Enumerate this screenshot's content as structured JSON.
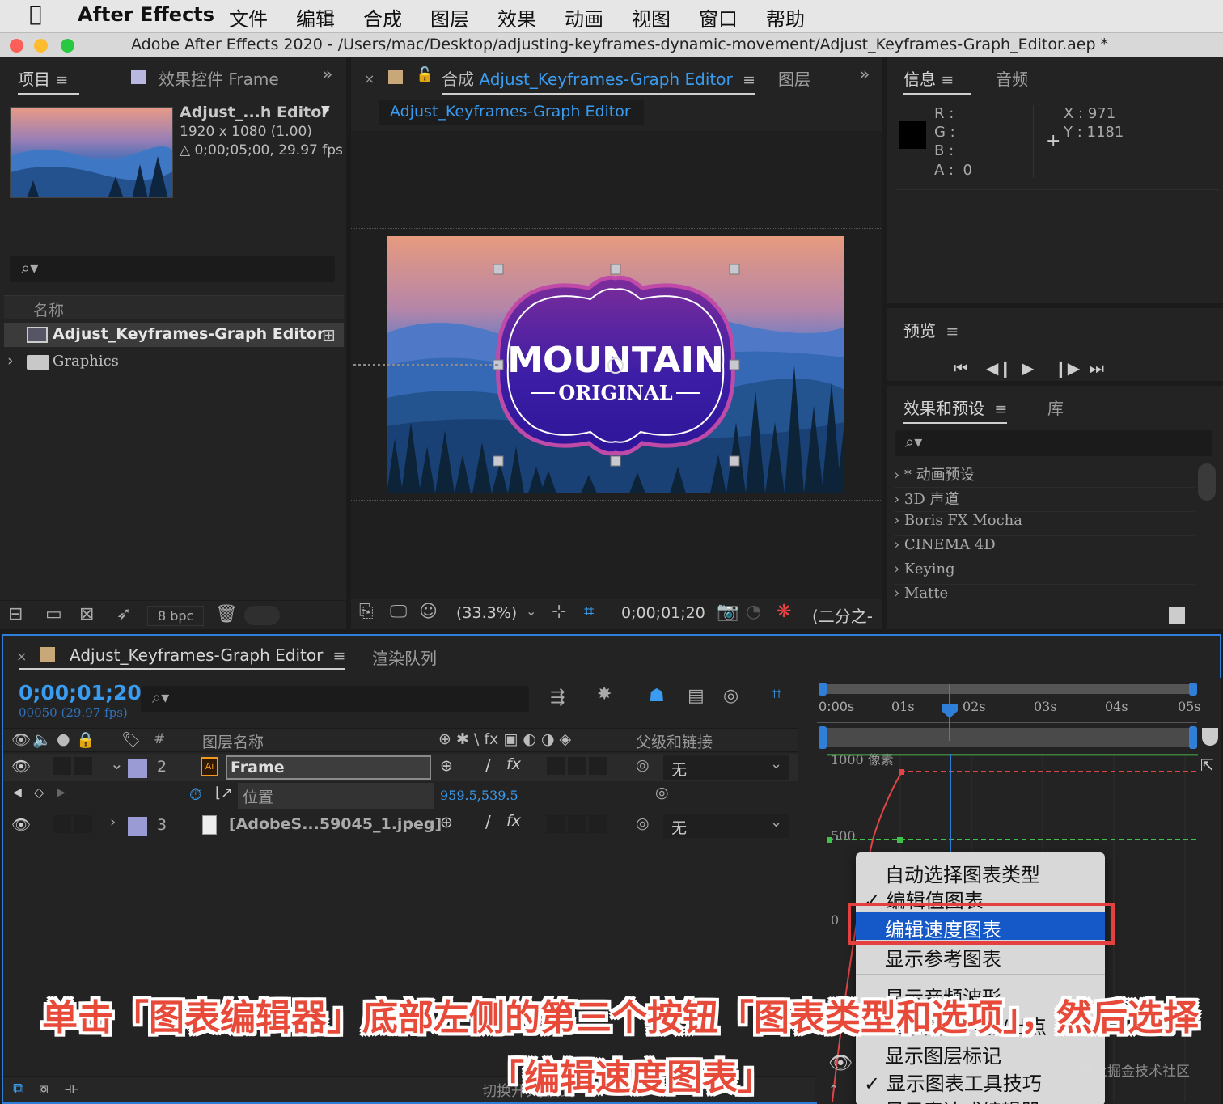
{
  "menubar": {
    "app": "After Effects",
    "items": [
      "文件",
      "编辑",
      "合成",
      "图层",
      "效果",
      "动画",
      "视图",
      "窗口",
      "帮助"
    ]
  },
  "window": {
    "title": "Adobe After Effects 2020 - /Users/mac/Desktop/adjusting-keyframes-dynamic-movement/Adjust_Keyframes-Graph_Editor.aep *"
  },
  "project": {
    "tab_project": "项目",
    "tab_effects": "效果控件 Frame",
    "comp_name": "Adjust_...h Editor",
    "comp_size": "1920 x 1080 (1.00)",
    "comp_duration": "△ 0;00;05;00, 29.97 fps",
    "col_name": "名称",
    "items": [
      {
        "name": "Adjust_Keyframes-Graph Editor"
      },
      {
        "name": "Graphics"
      }
    ],
    "bpc": "8 bpc"
  },
  "composition": {
    "tab_label": "合成",
    "tab_name": "Adjust_Keyframes-Graph Editor",
    "tab_layer": "图层",
    "subtab": "Adjust_Keyframes-Graph Editor",
    "badge_line1": "MOUNTAIN",
    "badge_line2": "ORIGINAL",
    "zoom": "(33.3%)",
    "timecode": "0;00;01;20",
    "resolution": "(二分之-"
  },
  "info": {
    "tab_info": "信息",
    "tab_audio": "音频",
    "r": "R :",
    "g": "G :",
    "b": "B :",
    "a": "A :  0",
    "x": "X : 971",
    "y": "Y : 1181"
  },
  "preview": {
    "title": "预览"
  },
  "effects": {
    "tab_effects": "效果和预设",
    "tab_library": "库",
    "items": [
      "* 动画预设",
      "3D 声道",
      "Boris FX Mocha",
      "CINEMA 4D",
      "Keying",
      "Matte"
    ]
  },
  "timeline": {
    "tab_comp": "Adjust_Keyframes-Graph Editor",
    "tab_render": "渲染队列",
    "timecode": "0;00;01;20",
    "frames": "00050 (29.97 fps)",
    "col_hash": "#",
    "col_layer": "图层名称",
    "col_switches": "⊕ ✱ \\ fx ▣ ◐ ◑ ◈",
    "col_parent": "父级和链接",
    "layers": [
      {
        "num": "2",
        "name": "Frame",
        "parent": "无"
      },
      {
        "prop": "位置",
        "value": "959.5,539.5"
      },
      {
        "num": "3",
        "name": "[AdobeS...59045_1.jpeg]",
        "parent": "无"
      }
    ],
    "ruler": [
      "0:00s",
      "01s",
      "02s",
      "03s",
      "04s",
      "05s"
    ],
    "graph_labels": [
      "1000 像素",
      "500",
      "0"
    ],
    "bottom": "切换开关/模式"
  },
  "context_menu": {
    "items": [
      "自动选择图表类型",
      "编辑值图表",
      "编辑速度图表",
      "显示参考图表",
      "显示音频波形",
      "显示图层入点/出点",
      "显示图层标记",
      "显示图表工具技巧",
      "显示表达式编辑器"
    ],
    "checked": [
      "编辑值图表",
      "显示图表工具技巧"
    ],
    "highlighted": "编辑速度图表"
  },
  "caption": {
    "line1": "单击「图表编辑器」底部左侧的第三个按钮「图表类型和选项」，然后选择",
    "line2": "「编辑速度图表」"
  },
  "watermark": "@稀土掘金技术社区",
  "colors": {
    "accent_blue": "#3a9cf0",
    "highlight": "#1559c8",
    "caption_red": "#e84a3a",
    "label_purple": "#9a9ad4"
  }
}
